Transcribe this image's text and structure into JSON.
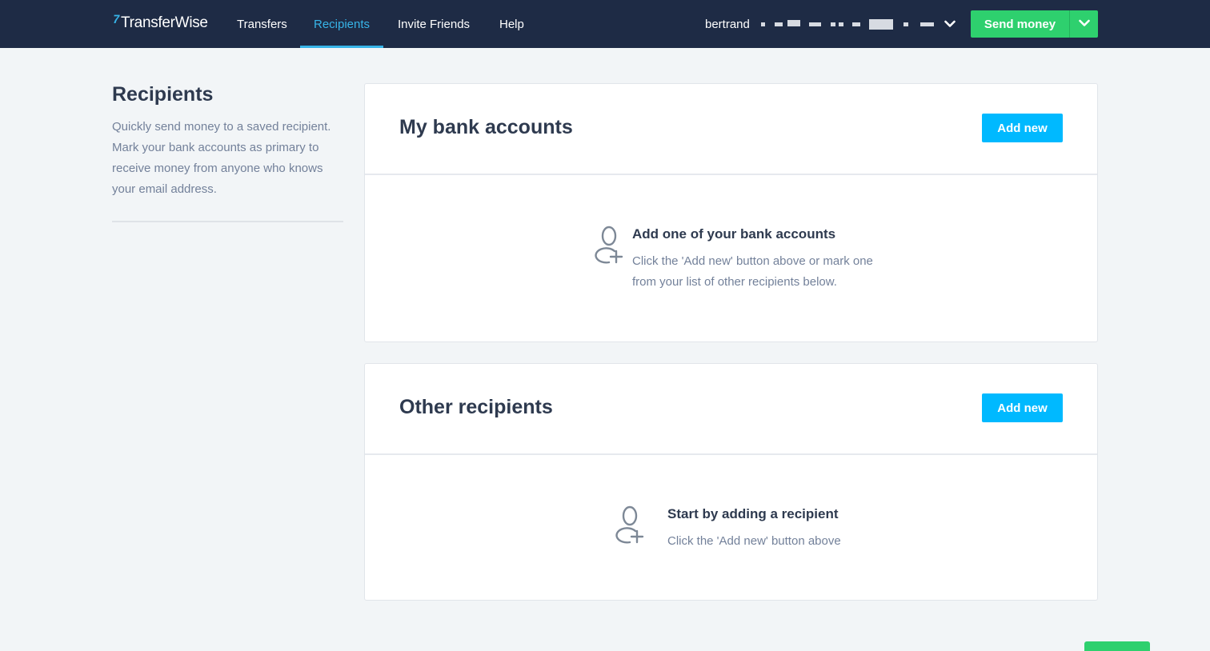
{
  "app": {
    "logo_text": "TransferWise",
    "logo_mark": "7"
  },
  "nav": {
    "items": [
      {
        "label": "Transfers",
        "active": false
      },
      {
        "label": "Recipients",
        "active": true
      },
      {
        "label": "Invite Friends",
        "active": false
      },
      {
        "label": "Help",
        "active": false
      }
    ]
  },
  "user": {
    "name": "bertrand"
  },
  "send_money": {
    "label": "Send money"
  },
  "intro": {
    "title": "Recipients",
    "text": "Quickly send money to a saved recipient. Mark your bank accounts as primary to receive money from anyone who knows your email address."
  },
  "bank_accounts": {
    "title": "My bank accounts",
    "add_label": "Add new",
    "empty_title": "Add one of your bank accounts",
    "empty_text": "Click the 'Add new' button above or mark one from your list of other recipients below."
  },
  "other_recipients": {
    "title": "Other recipients",
    "add_label": "Add new",
    "empty_title": "Start by adding a recipient",
    "empty_text": "Click the 'Add new' button above"
  },
  "icons": {
    "user_add": "add-user-icon",
    "chevron": "chevron-down-icon"
  },
  "colors": {
    "nav_bg": "#1e2b45",
    "accent": "#37b4e8",
    "primary_button": "#00b9ff",
    "send_button": "#2ed06e",
    "page_bg": "#f2f5f7"
  }
}
